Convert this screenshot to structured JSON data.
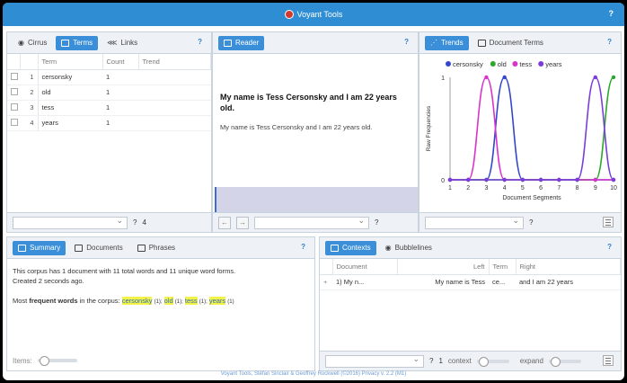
{
  "app": {
    "title": "Voyant Tools",
    "help": "?"
  },
  "cirrus_panel": {
    "tabs": [
      "Cirrus",
      "Terms",
      "Links"
    ],
    "help": "?",
    "columns": [
      "Term",
      "Count",
      "Trend"
    ],
    "rows": [
      {
        "n": "1",
        "term": "cersonsky",
        "count": "1"
      },
      {
        "n": "2",
        "term": "old",
        "count": "1"
      },
      {
        "n": "3",
        "term": "tess",
        "count": "1"
      },
      {
        "n": "4",
        "term": "years",
        "count": "1"
      }
    ],
    "footer_help": "?",
    "footer_count": "4"
  },
  "reader_panel": {
    "tab": "Reader",
    "help": "?",
    "heading": "My name is Tess Cersonsky and I am 22 years old.",
    "body": "My name is Tess Cersonsky and I am 22 years old.",
    "footer_help": "?"
  },
  "trends_panel": {
    "tabs": [
      "Trends",
      "Document Terms"
    ],
    "help": "?",
    "footer_help": "?"
  },
  "chart_data": {
    "type": "line",
    "xlabel": "Document Segments",
    "ylabel": "Raw Frequencies",
    "x": [
      1,
      2,
      3,
      4,
      5,
      6,
      7,
      8,
      9,
      10
    ],
    "ylim": [
      0,
      1
    ],
    "yticks": [
      0,
      1
    ],
    "legend_position": "top",
    "series": [
      {
        "name": "cersonsky",
        "color": "#3346cc",
        "values": [
          0,
          0,
          0,
          1,
          0,
          0,
          0,
          0,
          0,
          0
        ]
      },
      {
        "name": "old",
        "color": "#2aa82a",
        "values": [
          0,
          0,
          0,
          0,
          0,
          0,
          0,
          0,
          0,
          1
        ]
      },
      {
        "name": "tess",
        "color": "#d933cc",
        "values": [
          0,
          0,
          1,
          0,
          0,
          0,
          0,
          0,
          0,
          0
        ]
      },
      {
        "name": "years",
        "color": "#7a3ddb",
        "values": [
          0,
          0,
          0,
          0,
          0,
          0,
          0,
          0,
          1,
          0
        ]
      }
    ]
  },
  "summary_panel": {
    "tabs": [
      "Summary",
      "Documents",
      "Phrases"
    ],
    "help": "?",
    "line1": "This corpus has 1 document with 11 total words and 11 unique word forms.",
    "line2": "Created 2 seconds ago.",
    "freq_prefix": "Most ",
    "freq_bold": "frequent words",
    "freq_suffix": " in the corpus: ",
    "words": [
      {
        "word": "cersonsky",
        "count": "(1);"
      },
      {
        "word": "old",
        "count": "(1);"
      },
      {
        "word": "tess",
        "count": "(1);"
      },
      {
        "word": "years",
        "count": "(1)"
      }
    ],
    "items_label": "Items:"
  },
  "contexts_panel": {
    "tabs": [
      "Contexts",
      "Bubblelines"
    ],
    "help": "?",
    "columns": [
      "Document",
      "Left",
      "Term",
      "Right"
    ],
    "row": {
      "expand": "+",
      "doc": "1) My n...",
      "left": "My name is Tess",
      "term": "ce...",
      "right": "and I am 22 years"
    },
    "footer_help": "?",
    "context_value": "1",
    "context_label": "context",
    "expand_label": "expand"
  },
  "footer_text": "Voyant Tools, Stéfan Sinclair & Geoffrey Rockwell (©2016) Privacy v. 2.2 (M1)"
}
